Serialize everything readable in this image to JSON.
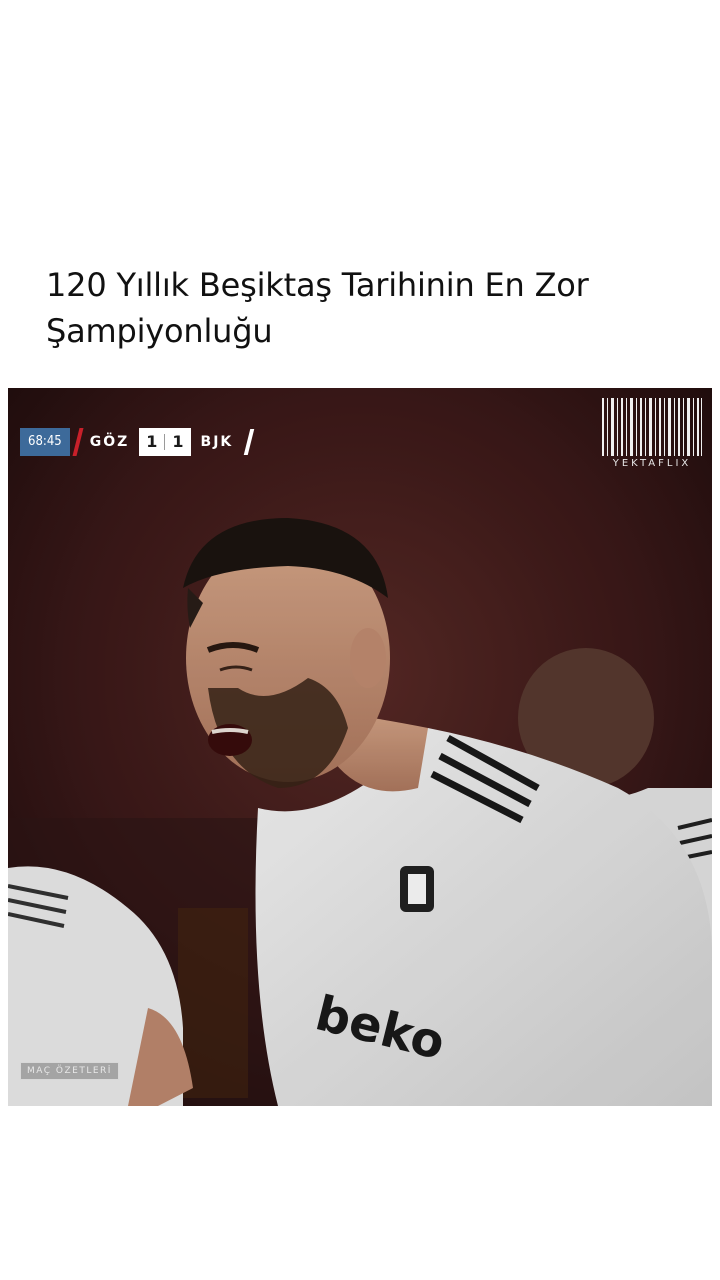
{
  "post": {
    "title": "120 Yıllık Beşiktaş Tarihinin En Zor Şampiyonluğu"
  },
  "video": {
    "scorebar": {
      "time": "68:45",
      "home_team": "GÖZ",
      "home_score": "1",
      "away_score": "1",
      "away_team": "BJK"
    },
    "watermark": "YEKTAFLIX",
    "badge": "MAÇ ÖZETLERİ",
    "jersey_sponsor": "beko"
  },
  "colors": {
    "scorebar_time_bg": "#3d6a9a",
    "scorebar_accent": "#c8202a",
    "stadium_bg": "#3a1a1a",
    "jersey": "#f2f2f2"
  }
}
